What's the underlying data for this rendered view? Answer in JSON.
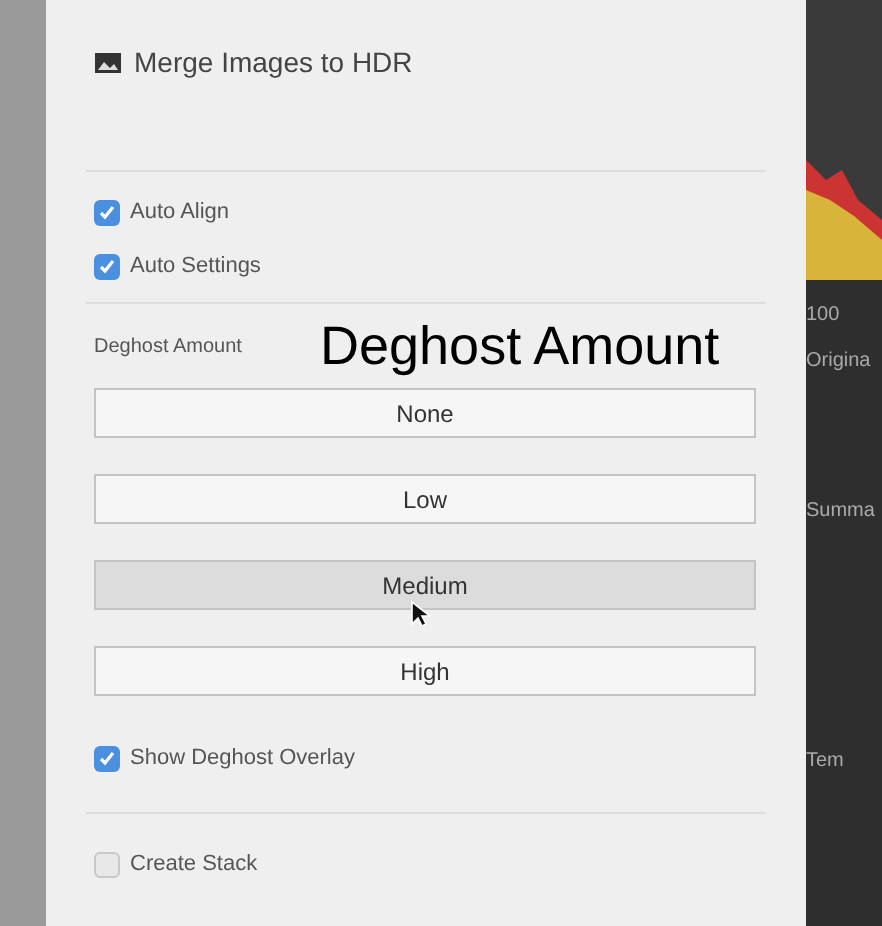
{
  "dialog": {
    "title": "Merge Images to HDR"
  },
  "options": [
    {
      "label": "Auto Align",
      "checked": true
    },
    {
      "label": "Auto Settings",
      "checked": true
    }
  ],
  "deghost": {
    "label": "Deghost Amount",
    "caption": "Deghost Amount",
    "buttons": [
      {
        "label": "None",
        "selected": false
      },
      {
        "label": "Low",
        "selected": false
      },
      {
        "label": "Medium",
        "selected": true
      },
      {
        "label": "High",
        "selected": false
      }
    ]
  },
  "overlay_option": {
    "label": "Show Deghost Overlay",
    "checked": true
  },
  "stack_option": {
    "label": "Create Stack",
    "checked": false
  },
  "background_panel": {
    "texts": [
      "100",
      "Origina",
      "Summa",
      "Tem"
    ]
  }
}
